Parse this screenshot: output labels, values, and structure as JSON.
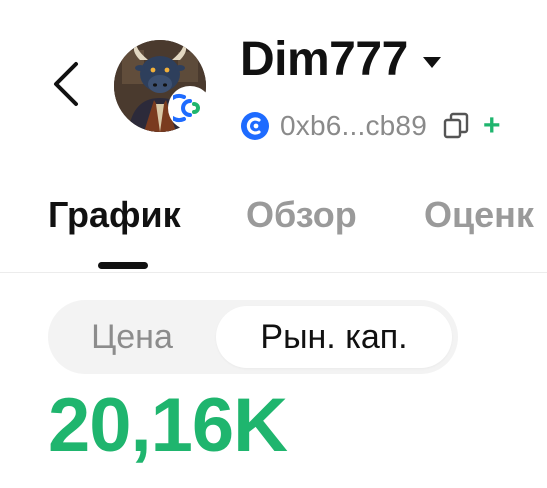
{
  "header": {
    "username": "Dim777",
    "address": "0xb6...cb89",
    "plus_label": "+",
    "colors": {
      "accent_green": "#1fb56e",
      "badge_blue": "#1e6bff"
    },
    "icons": [
      "back-arrow-icon",
      "dropdown-caret-icon",
      "chain-badge-icon",
      "copy-icon",
      "plus-icon"
    ]
  },
  "tabs": [
    {
      "label": "График",
      "active": true
    },
    {
      "label": "Обзор",
      "active": false
    },
    {
      "label": "Оценк",
      "active": false
    }
  ],
  "metric_toggle": {
    "options": [
      {
        "label": "Цена",
        "selected": false
      },
      {
        "label": "Рын. кап.",
        "selected": true
      }
    ]
  },
  "value": {
    "display": "20,16K"
  }
}
